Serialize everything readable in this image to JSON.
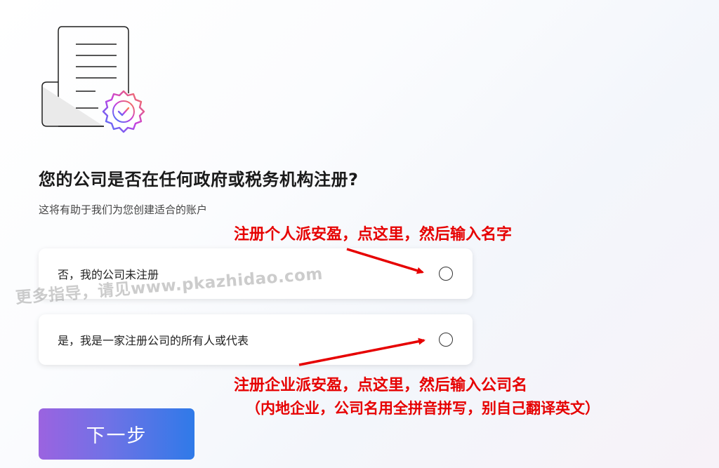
{
  "question": {
    "title": "您的公司是否在任何政府或税务机构注册?",
    "subtitle": "这将有助于我们为您创建适合的账户"
  },
  "options": [
    {
      "label": "否，我的公司未注册",
      "selected": false
    },
    {
      "label": "是，我是一家注册公司的所有人或代表",
      "selected": false
    }
  ],
  "next_button": {
    "label": "下一步"
  },
  "annotations": {
    "personal": "注册个人派安盈，点这里，然后输入名字",
    "business": "注册企业派安盈，点这里，然后输入公司名",
    "business_note": "（内地企业，公司名用全拼音拼写，别自己翻译英文）",
    "color": "#e60000"
  },
  "watermark": "更多指导，请见www.pkazhidao.com",
  "colors": {
    "button_gradient": [
      "#9b63e0",
      "#2f7ae8"
    ],
    "text": "#1a1a1a"
  },
  "icons": [
    "document-icon",
    "verified-badge-icon",
    "radio-icon",
    "arrow-icon"
  ]
}
